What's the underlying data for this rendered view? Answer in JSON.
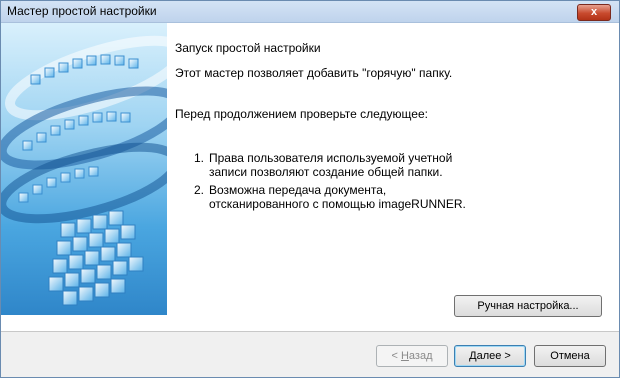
{
  "window": {
    "title": "Мастер простой настройки",
    "close_label": "x"
  },
  "content": {
    "heading": "Запуск простой настройки",
    "intro": "Этот мастер позволяет добавить \"горячую\" папку.",
    "check_prompt": "Перед продолжением проверьте следующее:",
    "items": [
      {
        "num": "1.",
        "line1": "Права пользователя используемой учетной",
        "line2": "записи позволяют создание общей папки."
      },
      {
        "num": "2.",
        "line1": "Возможна передача документа,",
        "line2": "отсканированного с помощью imageRUNNER."
      }
    ]
  },
  "buttons": {
    "manual_label": "Ручная настройка...",
    "back_prefix": "< ",
    "back_mnemonic": "Н",
    "back_rest": "азад",
    "next_mnemonic": "Д",
    "next_rest": "алее >",
    "cancel_label": "Отмена"
  }
}
